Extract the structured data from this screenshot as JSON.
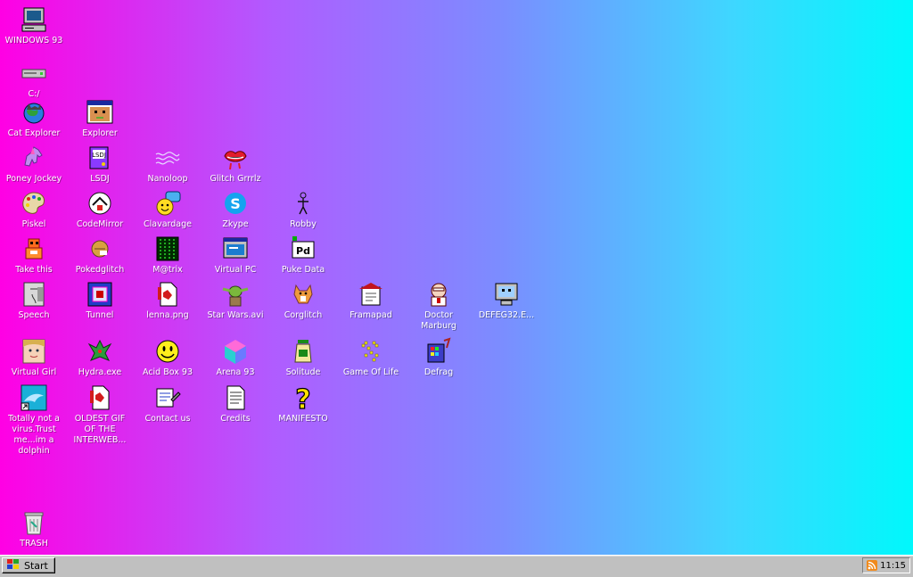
{
  "desktop": {
    "icons": [
      {
        "label": "WINDOWS 93",
        "icon": "computer-icon"
      },
      {
        "label": "C:/",
        "icon": "drive-icon"
      },
      {
        "label": "Cat Explorer",
        "icon": "globe-cat-icon"
      },
      {
        "label": "Explorer",
        "icon": "explorer-window-icon"
      },
      {
        "label": "Poney Jockey",
        "icon": "pony-icon"
      },
      {
        "label": "LSDJ",
        "icon": "lsdj-icon"
      },
      {
        "label": "Nanoloop",
        "icon": "nanoloop-wave-icon"
      },
      {
        "label": "Glitch Grrrlz",
        "icon": "lips-icon"
      },
      {
        "label": "Piskel",
        "icon": "palette-icon"
      },
      {
        "label": "CodeMirror",
        "icon": "codemirror-icon"
      },
      {
        "label": "Clavardage",
        "icon": "chat-smiley-icon"
      },
      {
        "label": "Zkype",
        "icon": "zkype-icon"
      },
      {
        "label": "Robby",
        "icon": "stick-figure-icon"
      },
      {
        "label": "Take this",
        "icon": "take-this-icon"
      },
      {
        "label": "Pokedglitch",
        "icon": "pokedglitch-icon"
      },
      {
        "label": "M@trix",
        "icon": "matrix-icon"
      },
      {
        "label": "Virtual PC",
        "icon": "virtual-pc-icon"
      },
      {
        "label": "Puke Data",
        "icon": "puredata-icon"
      },
      {
        "label": "Speech",
        "icon": "speech-face-icon"
      },
      {
        "label": "Tunnel",
        "icon": "tunnel-icon"
      },
      {
        "label": "lenna.png",
        "icon": "image-file-icon"
      },
      {
        "label": "Star Wars.avi",
        "icon": "yoda-icon"
      },
      {
        "label": "Corglitch",
        "icon": "corgi-icon"
      },
      {
        "label": "Framapad",
        "icon": "framapad-icon"
      },
      {
        "label": "Doctor Marburg",
        "icon": "doctor-icon"
      },
      {
        "label": "DEFEG32.E...",
        "icon": "monitor-face-icon"
      },
      {
        "label": "Virtual Girl",
        "icon": "virtual-girl-icon"
      },
      {
        "label": "Hydra.exe",
        "icon": "hydra-icon"
      },
      {
        "label": "Acid Box 93",
        "icon": "acid-smiley-icon"
      },
      {
        "label": "Arena 93",
        "icon": "cube-icon"
      },
      {
        "label": "Solitude",
        "icon": "solitude-icon"
      },
      {
        "label": "Game Of Life",
        "icon": "game-of-life-icon"
      },
      {
        "label": "Defrag",
        "icon": "defrag-icon"
      },
      {
        "label": "Totally not a virus.Trust me...im a dolphin",
        "icon": "dolphin-shortcut-icon"
      },
      {
        "label": "OLDEST GIF OF THE INTERWEB...",
        "icon": "gif-file-icon"
      },
      {
        "label": "Contact us",
        "icon": "contact-icon"
      },
      {
        "label": "Credits",
        "icon": "document-icon"
      },
      {
        "label": "MANIFESTO",
        "icon": "question-icon"
      },
      {
        "label": "TRASH",
        "icon": "trash-icon"
      }
    ]
  },
  "taskbar": {
    "start_label": "Start",
    "tray_icon": "rss-icon",
    "clock": "11:15"
  },
  "colors": {
    "gradient_left": "#ff00e4",
    "gradient_right": "#00f8fc",
    "taskbar": "#c0c0c0"
  }
}
